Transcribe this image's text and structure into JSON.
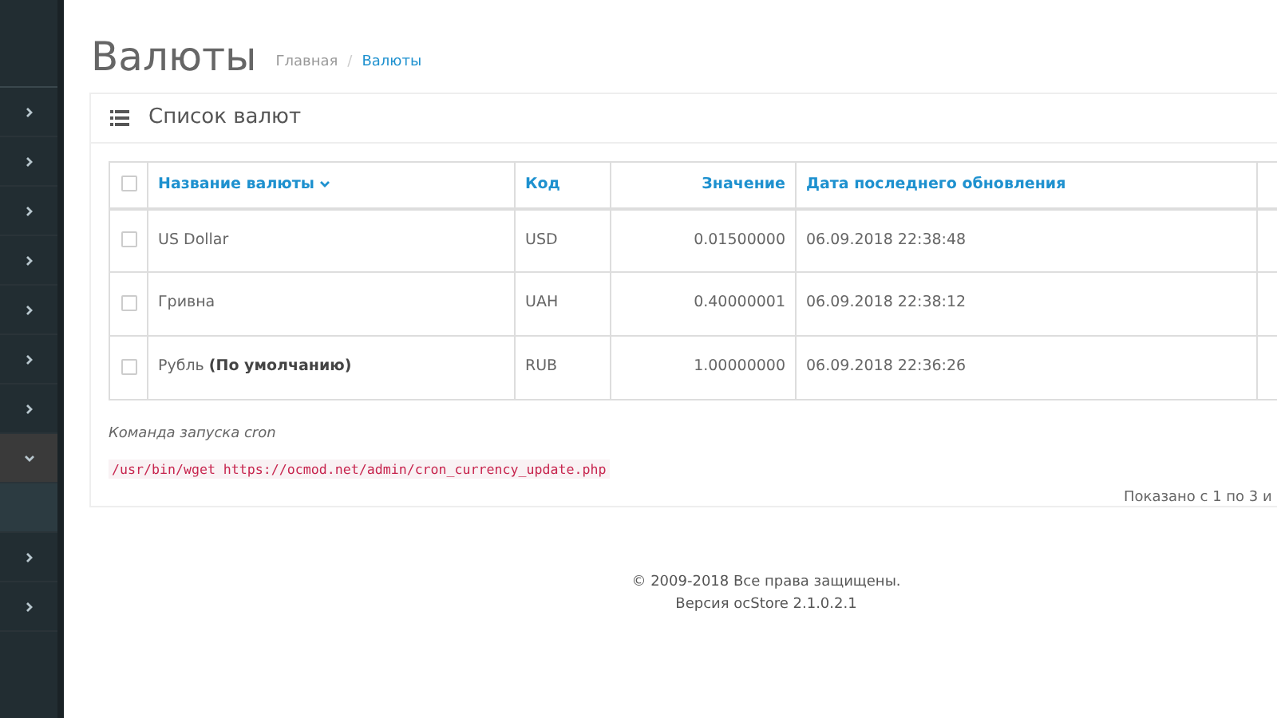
{
  "sidebar": {
    "items": [
      {
        "expanded": false
      },
      {
        "expanded": false
      },
      {
        "expanded": false
      },
      {
        "expanded": false
      },
      {
        "expanded": false
      },
      {
        "expanded": false
      },
      {
        "expanded": false
      },
      {
        "expanded": true
      },
      {
        "expanded": false
      },
      {
        "expanded": false
      }
    ]
  },
  "page": {
    "title": "Валюты",
    "breadcrumb_separator": "/",
    "breadcrumbs": [
      {
        "label": "Главная",
        "selected": false
      },
      {
        "label": "Валюты",
        "selected": true
      }
    ]
  },
  "panel": {
    "title": "Список валют",
    "table": {
      "header_checkbox": {
        "checked": false
      },
      "columns": [
        {
          "label": "Название валюты",
          "sorted": true,
          "kind": "text"
        },
        {
          "label": "Код",
          "sorted": false,
          "kind": "text"
        },
        {
          "label": "Значение",
          "sorted": false,
          "kind": "number"
        },
        {
          "label": "Дата последнего обновления",
          "sorted": false,
          "kind": "text"
        }
      ],
      "rows": [
        {
          "checked": false,
          "cells": [
            "US Dollar",
            "USD",
            "0.01500000",
            "06.09.2018 22:38:48"
          ]
        },
        {
          "checked": false,
          "cells": [
            "Гривна",
            "UAH",
            "0.40000001",
            "06.09.2018 22:38:12"
          ]
        },
        {
          "checked": false,
          "cells": [
            "Рубль **(По умолчанию)**",
            "RUB",
            "1.00000000",
            "06.09.2018 22:36:26"
          ]
        }
      ]
    },
    "cron_label": "Команда запуска cron",
    "cron_command": "/usr/bin/wget https://ocmod.net/admin/cron_currency_update.php",
    "pagination_text": "Показано с 1 по 3 и"
  },
  "footer": {
    "copyright": "© 2009-2018 Все права защищены.",
    "version": "Версия ocStore 2.1.0.2.1"
  }
}
